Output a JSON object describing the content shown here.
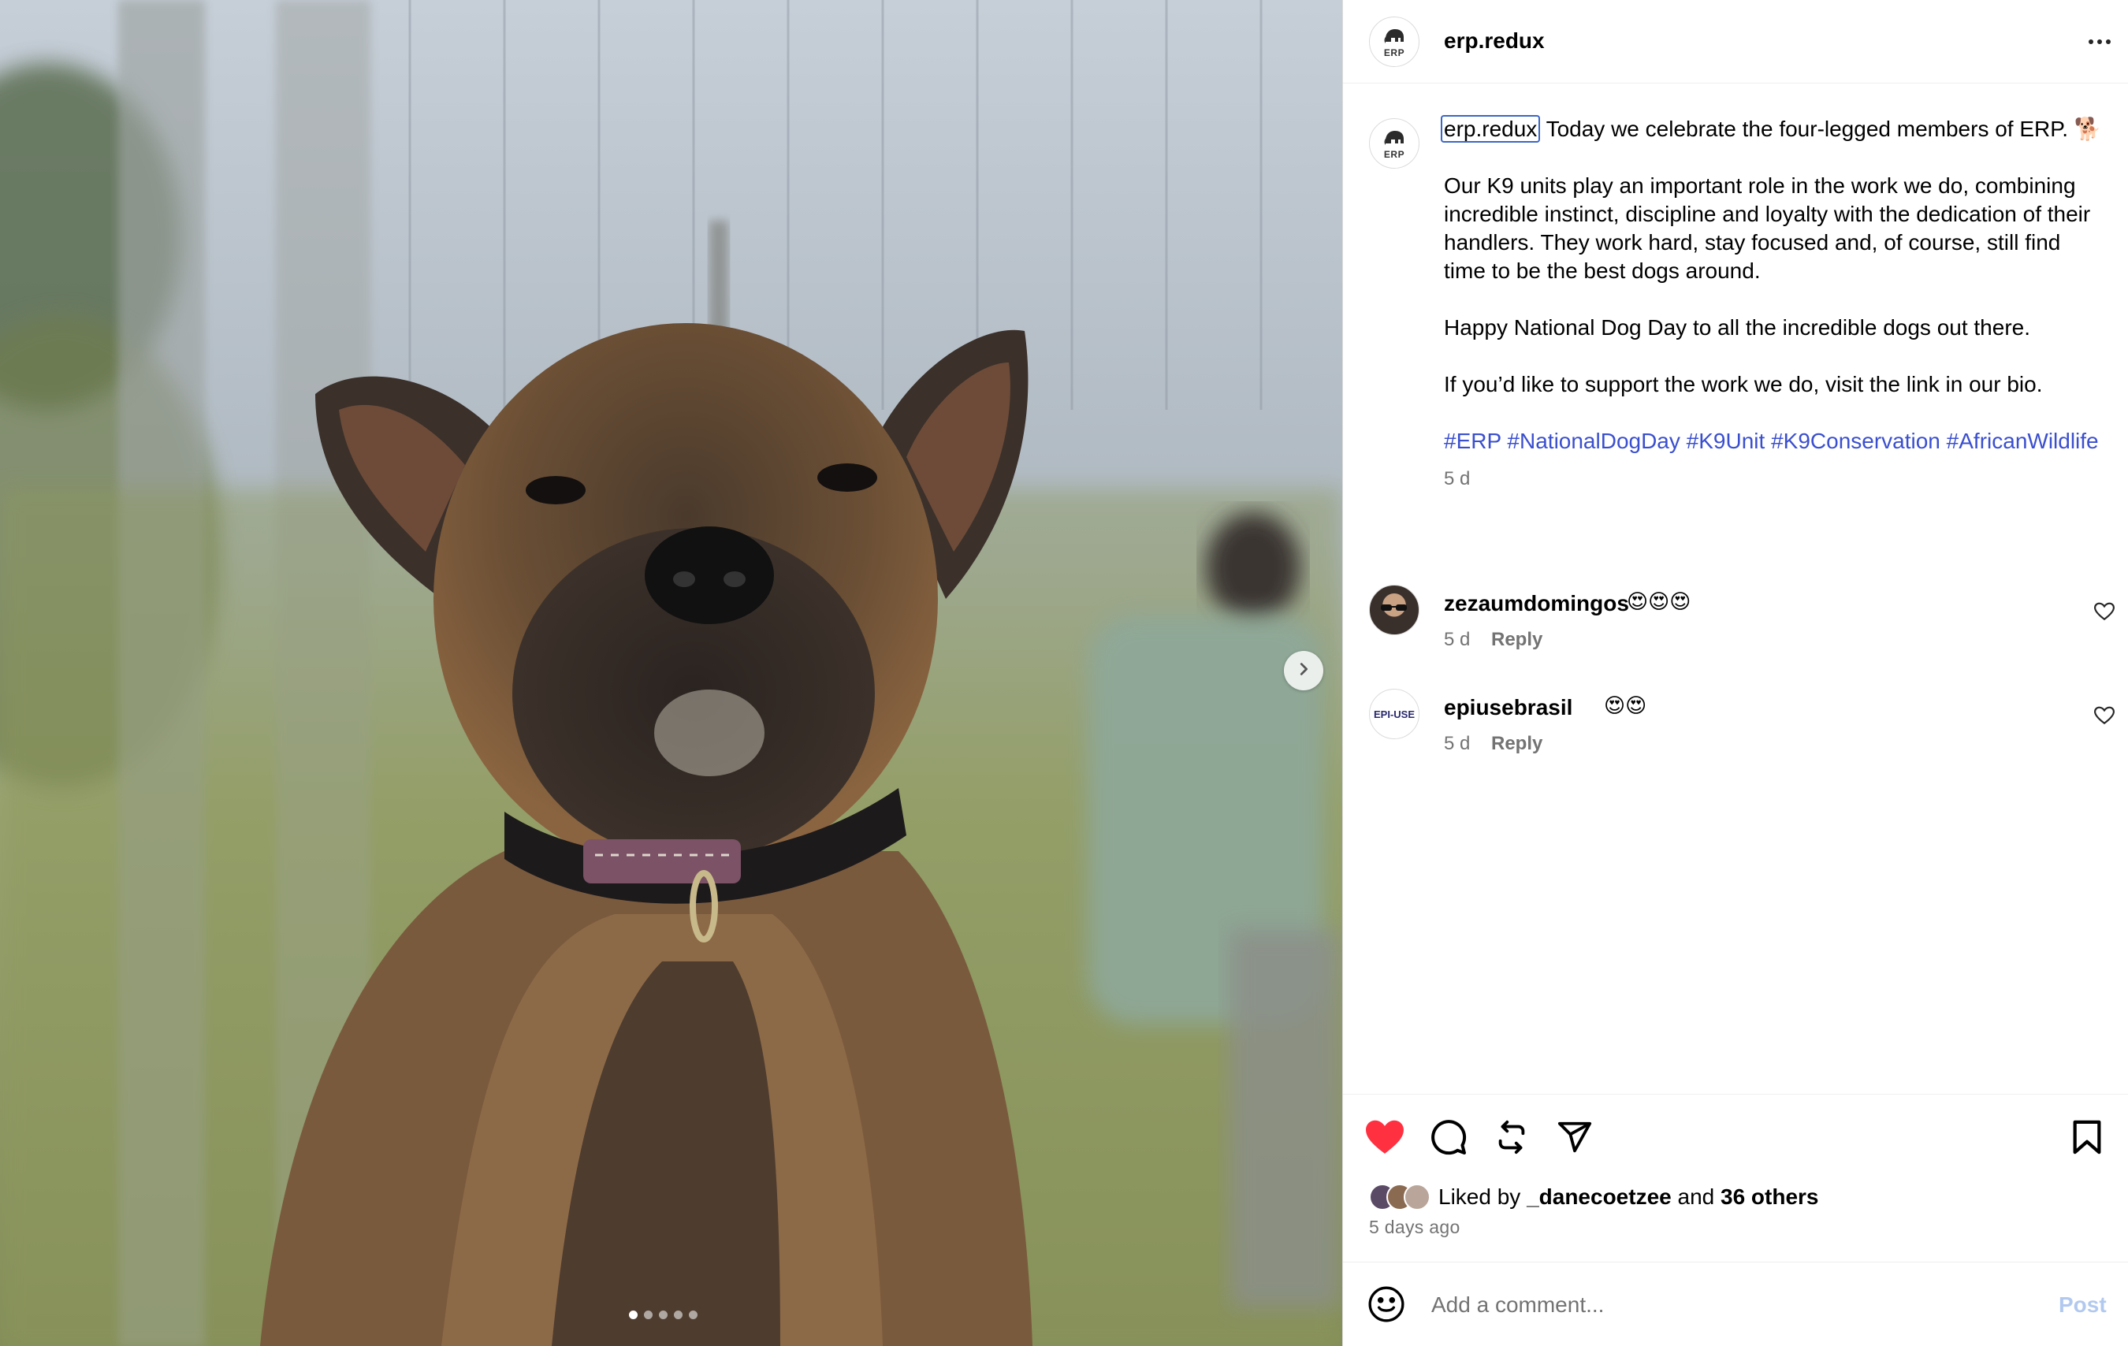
{
  "post": {
    "username": "erp.redux",
    "avatar_label": "ERP"
  },
  "caption": {
    "username": "erp.redux",
    "line1": "Today we celebrate the four-legged members of ERP. 🐕",
    "para2": "Our K9 units play an important role in the work we do, combining incredible instinct, discipline and loyalty with the dedication of their handlers. They work hard, stay focused and, of course, still find time to be the best dogs around.",
    "para3": "Happy National Dog Day to all the incredible dogs out there.",
    "para4": "If you’d like to support the work we do, visit the link in our bio.",
    "hashtags": [
      "#ERP",
      "#NationalDogDay",
      "#K9Unit",
      "#K9Conservation",
      "#AfricanWildlife"
    ],
    "time": "5 d"
  },
  "comments": [
    {
      "username": "zezaumdomingos",
      "text": "😍😍😍",
      "time": "5 d",
      "reply_label": "Reply"
    },
    {
      "username": "epiusebrasil",
      "text": "😍😍",
      "time": "5 d",
      "reply_label": "Reply",
      "avatar_label": "EPI-USE"
    }
  ],
  "likes": {
    "prefix": "Liked by",
    "user": "_danecoetzee",
    "conjunction": "and",
    "others": "36 others",
    "date": "5 days ago"
  },
  "comment_box": {
    "placeholder": "Add a comment...",
    "post_label": "Post"
  },
  "carousel": {
    "slide_count": 5,
    "active_index": 0
  },
  "colors": {
    "like_red": "#ff3040",
    "hashtag_blue": "#3a4fcf",
    "post_disabled": "#b2c9ef"
  },
  "icons": [
    "more-icon",
    "heart-icon",
    "comment-icon",
    "repost-icon",
    "share-icon",
    "bookmark-icon",
    "smiley-icon",
    "chevron-right-icon"
  ]
}
